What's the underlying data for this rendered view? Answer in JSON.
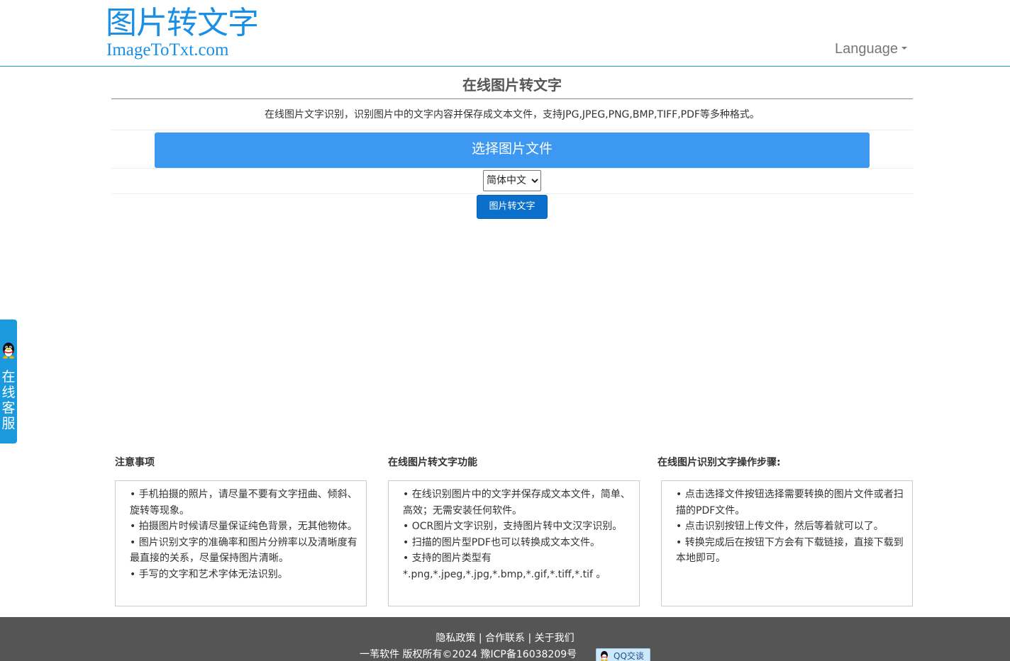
{
  "header": {
    "logo_cn": "图片转文字",
    "logo_en": "ImageToTxt.com",
    "language_label": "Language"
  },
  "main": {
    "title": "在线图片转文字",
    "subtitle": "在线图片文字识别，识别图片中的文字内容并保存成文本文件，支持JPG,JPEG,PNG,BMP,TIFF,PDF等多种格式。",
    "file_button": "选择图片文件",
    "language_select": "简体中文",
    "convert_button": "图片转文字"
  },
  "side_service": {
    "label": "在线客服",
    "icon": "qq-penguin-icon"
  },
  "columns": [
    {
      "title": "注意事项",
      "items": [
        "• 手机拍摄的照片，请尽量不要有文字扭曲、倾斜、旋转等现象。",
        "• 拍摄图片时候请尽量保证纯色背景，无其他物体。",
        "• 图片识别文字的准确率和图片分辨率以及清晰度有最直接的关系，尽量保持图片清晰。",
        "• 手写的文字和艺术字体无法识别。"
      ]
    },
    {
      "title": "在线图片转文字功能",
      "items": [
        "• 在线识别图片中的文字并保存成文本文件，简单、高效；无需安装任何软件。",
        "• OCR图片文字识别，支持图片转中文汉字识别。",
        "• 扫描的图片型PDF也可以转换成文本文件。",
        "• 支持的图片类型有 *.png,*.jpeg,*.jpg,*.bmp,*.gif,*.tiff,*.tif 。"
      ]
    },
    {
      "title": "在线图片识别文字操作步骤:",
      "items": [
        "•  点击选择文件按钮选择需要转换的图片文件或者扫描的PDF文件。",
        "•  点击识别按钮上传文件，然后等着就可以了。",
        "•  转换完成后在按钮下方会有下载链接，直接下载到本地即可。"
      ]
    }
  ],
  "footer": {
    "links": [
      "隐私政策",
      "合作联系",
      "关于我们"
    ],
    "separator": " | ",
    "copyright": "一苇软件 版权所有©2024 豫ICP备16038209号",
    "qq_button": "QQ交谈"
  },
  "colors": {
    "brand_blue": "#1a8fe3",
    "file_button": "#3d98f1",
    "convert_button": "#0b6fcc",
    "side_tab": "#1b99dd",
    "footer_bg": "#555555"
  }
}
